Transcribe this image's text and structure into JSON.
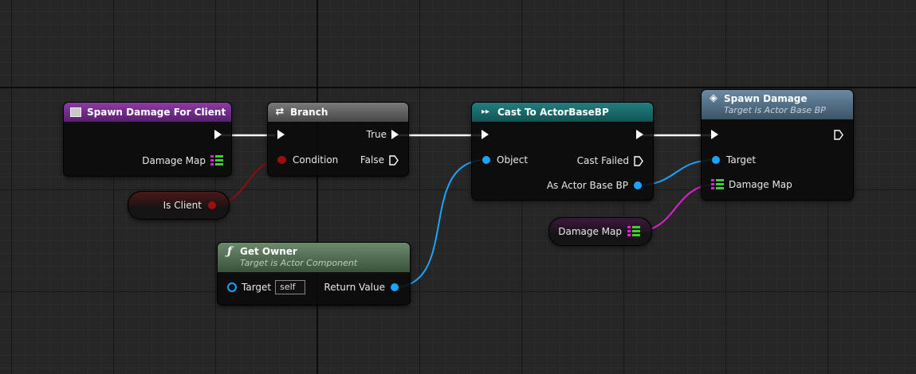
{
  "colors": {
    "event_header": "#6d2b83",
    "flow_header": "#5a5a5a",
    "cast_header": "#1a6b6b",
    "function_header": "#46654a",
    "spawn_header": "#4a6378",
    "exec_wire": "#ffffff",
    "bool_pin": "#9b0f0f",
    "object_pin": "#1aa3ff",
    "map_wire": "#e01fd6",
    "map_key": "#e01fd6",
    "map_value": "#3fcf2f"
  },
  "nodes": {
    "spawn_damage_for_client": {
      "title": "Spawn Damage For Client",
      "icon": "event-icon",
      "pins": {
        "damage_map": "Damage Map"
      }
    },
    "branch": {
      "title": "Branch",
      "icon": "branch-icon",
      "pins": {
        "condition": "Condition",
        "true": "True",
        "false": "False"
      }
    },
    "cast": {
      "title": "Cast To ActorBaseBP",
      "icon": "cast-icon",
      "pins": {
        "object": "Object",
        "cast_failed": "Cast Failed",
        "as_actor": "As Actor Base BP"
      }
    },
    "spawn_damage": {
      "title": "Spawn Damage",
      "subtitle": "Target is Actor Base BP",
      "icon": "function-diamond-icon",
      "pins": {
        "target": "Target",
        "damage_map": "Damage Map"
      }
    },
    "get_owner": {
      "title": "Get Owner",
      "subtitle": "Target is Actor Component",
      "icon": "function-f-icon",
      "pins": {
        "target": "Target",
        "self_value": "self",
        "return_value": "Return Value"
      }
    },
    "is_client": {
      "label": "Is Client"
    },
    "damage_map_var": {
      "label": "Damage Map"
    }
  }
}
